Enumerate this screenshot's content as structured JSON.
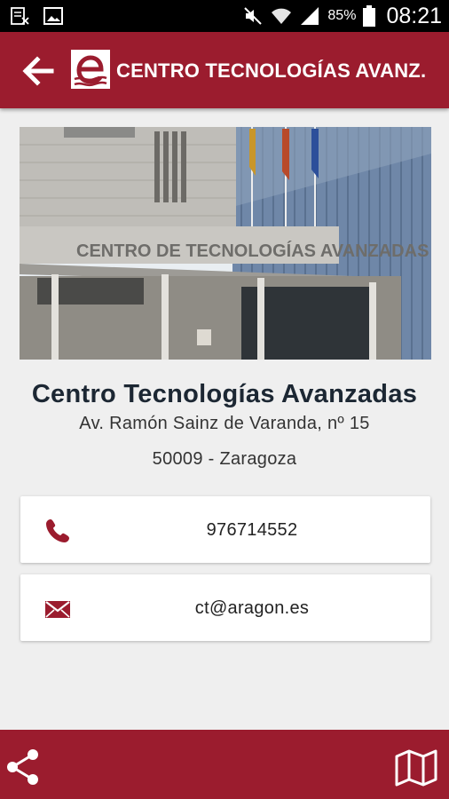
{
  "status_bar": {
    "battery": "85%",
    "time": "08:21",
    "icons": [
      "screenshot-icon",
      "image-icon",
      "mute-icon",
      "wifi-icon",
      "signal-icon",
      "battery-icon"
    ]
  },
  "app_bar": {
    "title": "CENTRO TECNOLOGÍAS AVANZ...",
    "back_icon": "arrow-left-icon",
    "logo": "e-logo"
  },
  "photo": {
    "sign_text": "CENTRO DE TECNOLOGÍAS AVANZADAS"
  },
  "details": {
    "name": "Centro Tecnologías Avanzadas",
    "address": "Av. Ramón Sainz de Varanda, nº 15",
    "postal": "50009 - Zaragoza"
  },
  "contacts": {
    "phone": "976714552",
    "email": "ct@aragon.es"
  },
  "bottom_bar": {
    "share_icon": "share-icon",
    "map_icon": "map-icon"
  },
  "colors": {
    "primary": "#9b1c2e",
    "background": "#efefef"
  }
}
